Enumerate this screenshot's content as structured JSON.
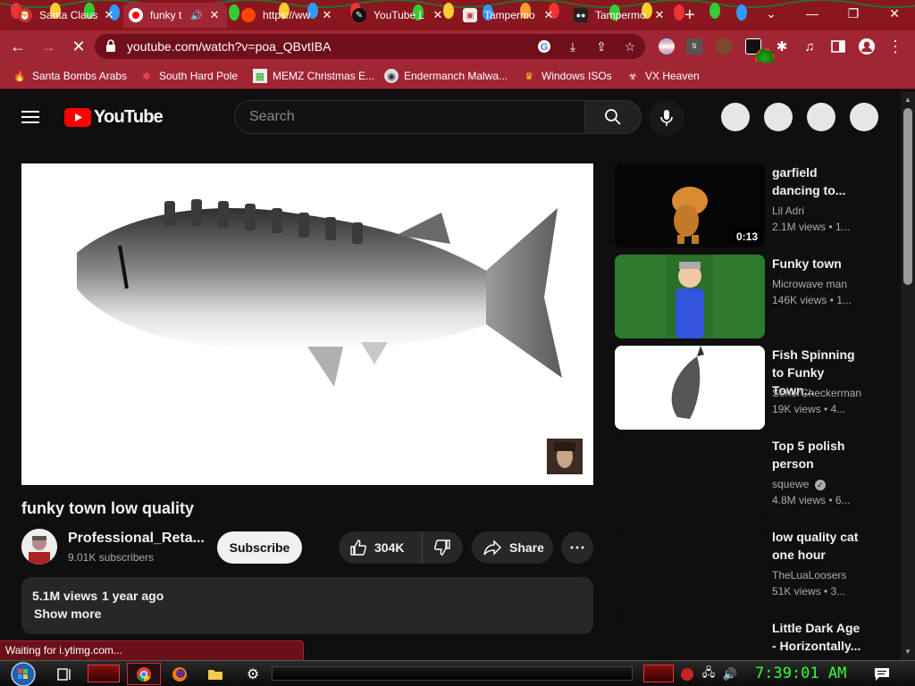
{
  "browser": {
    "tabs": [
      {
        "title": "Santa Claus",
        "icon": "santa-icon",
        "active": false
      },
      {
        "title": "funky t",
        "icon": "youtube-tab-icon",
        "active": true
      },
      {
        "title": "https://ww",
        "icon": "reddit-icon",
        "active": false
      },
      {
        "title": "YouTube L",
        "icon": "script-icon",
        "active": false
      },
      {
        "title": "Tampermo",
        "icon": "tampermonkey-icon",
        "active": false
      },
      {
        "title": "Tampermo",
        "icon": "tampermonkey-icon",
        "active": false
      }
    ],
    "new_tab_label": "+",
    "url": "youtube.com/watch?v=poa_QBvtIBA",
    "bookmarks": [
      {
        "label": "Santa Bombs Arabs",
        "icon": "fire-icon"
      },
      {
        "label": "South Hard Pole",
        "icon": "snowflake-icon"
      },
      {
        "label": "MEMZ Christmas E...",
        "icon": "memz-icon"
      },
      {
        "label": "Endermanch Malwa...",
        "icon": "globe-icon"
      },
      {
        "label": "Windows ISOs",
        "icon": "trophy-icon"
      },
      {
        "label": "VX Heaven",
        "icon": "biohazard-icon"
      }
    ],
    "status_text": "Waiting for i.ytimg.com..."
  },
  "youtube": {
    "logo_text": "YouTube",
    "search_placeholder": "Search",
    "video": {
      "title": "funky town low quality",
      "channel": "Professional_Reta...",
      "subscribers": "9.01K subscribers",
      "subscribe_label": "Subscribe",
      "likes": "304K",
      "share_label": "Share",
      "views": "5.1M views",
      "uploaded": "1 year ago",
      "show_more_label": "Show more"
    },
    "related": [
      {
        "title": "garfield dancing to...",
        "channel": "Lil Adri",
        "meta": "2.1M views • 1...",
        "duration": "0:13",
        "verified": false
      },
      {
        "title": "Funky town",
        "channel": "Microwave man",
        "meta": "146K views • 1...",
        "duration": "",
        "verified": false
      },
      {
        "title": "Fish Spinning to Funky Town...",
        "channel": "SenorCheckerman",
        "meta": "19K views • 4...",
        "duration": "",
        "verified": false
      },
      {
        "title": "Top 5 polish person",
        "channel": "squewe",
        "meta": "4.8M views • 6...",
        "duration": "",
        "verified": true
      },
      {
        "title": "low quality cat one hour",
        "channel": "TheLuaLoosers",
        "meta": "51K views • 3...",
        "duration": "",
        "verified": false
      },
      {
        "title": "Little Dark Age - Horizontally...",
        "channel": "",
        "meta": "",
        "duration": "",
        "verified": false
      }
    ]
  },
  "taskbar": {
    "clock": "7:39:01 AM"
  },
  "colors": {
    "browser_frame": "#a02634",
    "tab_strip": "#8a1620",
    "youtube_red": "#ff0000",
    "clock_green": "#32ff32",
    "yt_background": "#0f0f0f"
  }
}
